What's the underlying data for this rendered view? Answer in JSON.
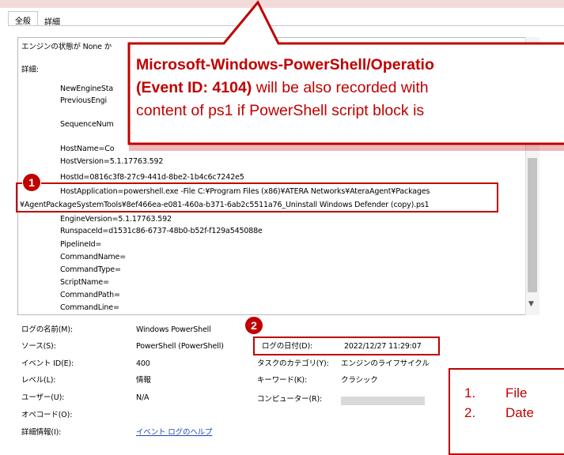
{
  "tabs": [
    "全般",
    "詳細"
  ],
  "pane": {
    "state_line": "エンジンの状態が None か",
    "details_label": "詳細:",
    "lines": [
      "NewEngineSta",
      "PreviousEngi",
      "SequenceNum",
      "HostName=Co",
      "HostVersion=5.1.17763.592",
      "HostId=0816c3f8-27c9-441d-8be2-1b4c6c7242e5",
      "HostApplication=powershell.exe -File C:¥Program Files (x86)¥ATERA Networks¥AteraAgent¥Packages",
      "¥AgentPackageSystemTools¥8ef466ea-e081-460a-b371-6ab2c5511a76_Uninstall Windows Defender (copy).ps1",
      "EngineVersion=5.1.17763.592",
      "RunspaceId=d1531c86-6737-48b0-b52f-f129a545088e",
      "PipelineId=",
      "CommandName=",
      "CommandType=",
      "ScriptName=",
      "CommandPath=",
      "CommandLine="
    ]
  },
  "meta": {
    "log_name_label": "ログの名前(M):",
    "log_name_value": "Windows PowerShell",
    "source_label": "ソース(S):",
    "source_value": "PowerShell (PowerShell)",
    "event_id_label": "イベント ID(E):",
    "event_id_value": "400",
    "level_label": "レベル(L):",
    "level_value": "情報",
    "user_label": "ユーザー(U):",
    "user_value": "N/A",
    "opcode_label": "オペコード(O):",
    "more_info_label": "詳細情報(I):",
    "more_info_link": "イベント ログのヘルプ",
    "date_label": "ログの日付(D):",
    "date_value": "2022/12/27 11:29:07",
    "task_label": "タスクのカテゴリ(Y):",
    "task_value": "エンジンのライフサイクル",
    "keyword_label": "キーワード(K):",
    "keyword_value": "クラシック",
    "computer_label": "コンピューター(R):"
  },
  "callout": {
    "line1_bold": "Microsoft-Windows-PowerShell/Operatio",
    "line2_bold": "(Event ID: 4104)",
    "line2_rest": " will be also recorded with",
    "line3": "content of ps1 if PowerShell script block is"
  },
  "badges": [
    "1",
    "2"
  ],
  "legend": [
    {
      "num": "1.",
      "text": "File"
    },
    {
      "num": "2.",
      "text": "Date"
    }
  ],
  "colors": {
    "accent": "#c00000",
    "link": "#1d47b8"
  }
}
